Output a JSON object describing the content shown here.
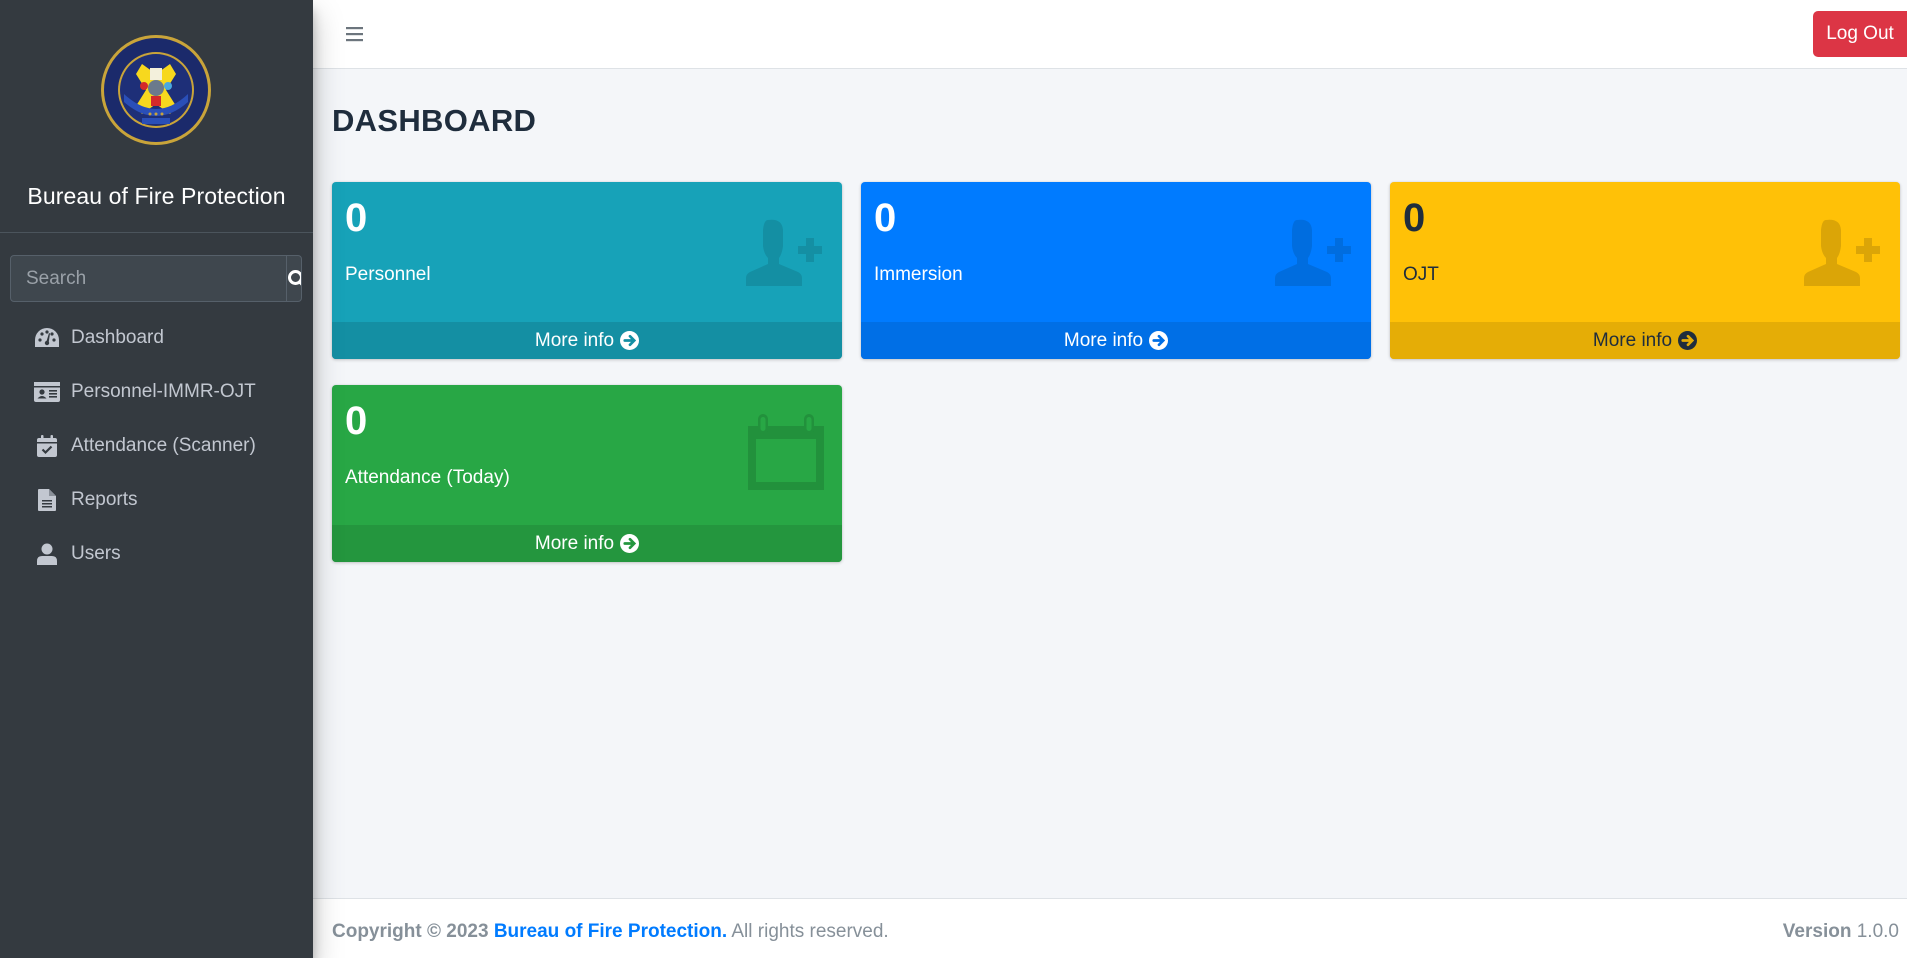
{
  "sidebar": {
    "brand_title": "Bureau of Fire Protection",
    "logo_icon": "bfp-seal-logo",
    "search": {
      "placeholder": "Search",
      "value": "",
      "button_icon": "search-icon"
    },
    "items": [
      {
        "label": "Dashboard",
        "icon": "tachometer-icon"
      },
      {
        "label": "Personnel-IMMR-OJT",
        "icon": "id-card-icon"
      },
      {
        "label": "Attendance (Scanner)",
        "icon": "calendar-check-icon"
      },
      {
        "label": "Reports",
        "icon": "file-text-icon"
      },
      {
        "label": "Users",
        "icon": "user-icon"
      }
    ]
  },
  "header": {
    "menu_icon": "hamburger-icon",
    "logout_label": "Log Out"
  },
  "main": {
    "page_title": "DASHBOARD",
    "cards": [
      {
        "count": "0",
        "label": "Personnel",
        "more": "More info",
        "icon": "user-plus-icon",
        "color": "#17a2b8"
      },
      {
        "count": "0",
        "label": "Immersion",
        "more": "More info",
        "icon": "user-plus-icon",
        "color": "#007bff"
      },
      {
        "count": "0",
        "label": "OJT",
        "more": "More info",
        "icon": "user-plus-icon",
        "color": "#ffc107"
      },
      {
        "count": "0",
        "label": "Attendance (Today)",
        "more": "More info",
        "icon": "calendar-icon",
        "color": "#28a745"
      }
    ]
  },
  "footer": {
    "copyright_prefix": "Copyright © 2023",
    "org_link": "Bureau of Fire Protection.",
    "rights": "All rights reserved.",
    "version_label": "Version",
    "version_value": "1.0.0"
  },
  "colors": {
    "sidebar_bg": "#343a40",
    "logout": "#dc3545",
    "link": "#007bff"
  }
}
